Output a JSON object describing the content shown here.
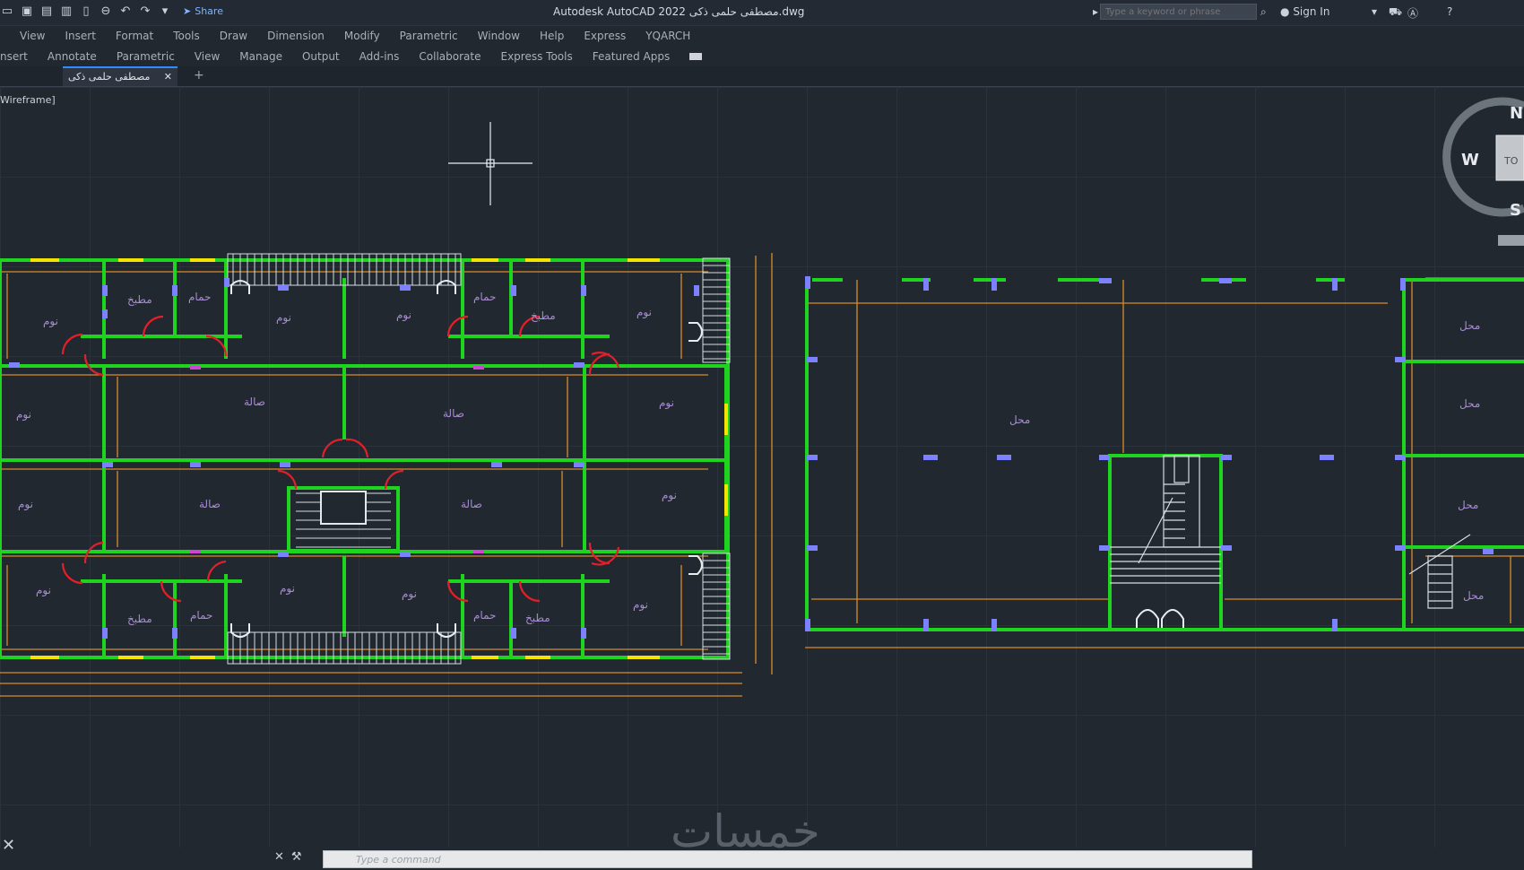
{
  "titlebar": {
    "share_label": "Share",
    "title": "Autodesk AutoCAD 2022    مصطفى حلمى ذكى.dwg",
    "search_placeholder": "Type a keyword or phrase",
    "sign_in": "Sign In"
  },
  "menu": [
    "View",
    "Insert",
    "Format",
    "Tools",
    "Draw",
    "Dimension",
    "Modify",
    "Parametric",
    "Window",
    "Help",
    "Express",
    "YQARCH"
  ],
  "ribbon_tabs": [
    "nsert",
    "Annotate",
    "Parametric",
    "View",
    "Manage",
    "Output",
    "Add-ins",
    "Collaborate",
    "Express Tools",
    "Featured Apps"
  ],
  "doc_tab": {
    "name": "مصطفى حلمى ذكى",
    "close": "✕",
    "new": "+"
  },
  "viewport_label": "Wireframe]",
  "viewcube": {
    "N": "N",
    "W": "W",
    "S": "S",
    "top": "TO"
  },
  "command": {
    "placeholder": "Type a command"
  },
  "watermark": "خمسات",
  "plan1": {
    "rooms": {
      "noum": "نوم",
      "matbakh": "مطبخ",
      "hammam": "حمام",
      "sala": "صالة"
    }
  },
  "plan2": {
    "rooms": {
      "mahal": "محل",
      "mahal_big": "محل"
    }
  },
  "colors": {
    "wall": "#1fd41f",
    "dim": "#d98a2a",
    "door": "#e0202a",
    "text": "#a98bd6",
    "column": "#6b72ff",
    "window": "#f4e500"
  }
}
